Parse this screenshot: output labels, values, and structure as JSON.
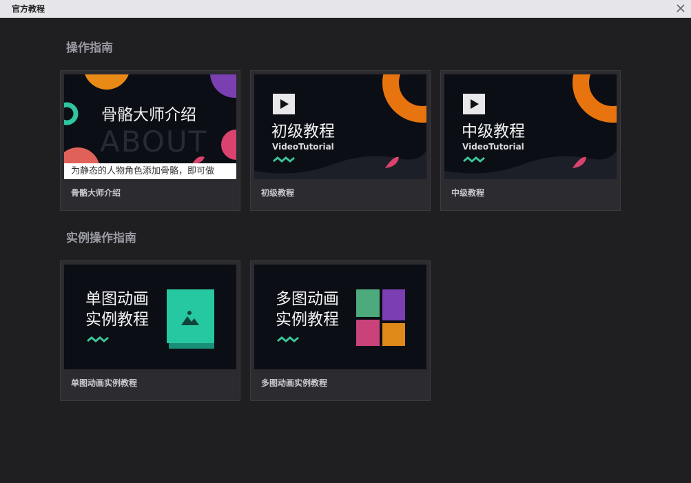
{
  "window": {
    "title": "官方教程"
  },
  "sections": [
    {
      "title": "操作指南",
      "cards": [
        {
          "label": "骨骼大师介绍",
          "heading": "骨骼大师介绍",
          "watermark": "ABOUT",
          "caption": "为静态的人物角色添加骨骼，即可做"
        },
        {
          "label": "初级教程",
          "heading": "初级教程",
          "sub": "VideoTutorial"
        },
        {
          "label": "中级教程",
          "heading": "中级教程",
          "sub": "VideoTutorial"
        }
      ]
    },
    {
      "title": "实例操作指南",
      "cards": [
        {
          "label": "单图动画实例教程",
          "line1": "单图动画",
          "line2": "实例教程"
        },
        {
          "label": "多图动画实例教程",
          "line1": "多图动画",
          "line2": "实例教程"
        }
      ]
    }
  ],
  "icons": {
    "close": "close-icon",
    "play": "play-icon",
    "wave": "wave-icon",
    "image": "image-icon"
  },
  "colors": {
    "accent_green": "#2ec5a0",
    "orange": "#e98a17",
    "purple": "#7a3fb0",
    "pink": "#d9436e",
    "grid_green": "#4caa7c",
    "grid_purple": "#7b3fb3",
    "grid_pink": "#c9437a",
    "grid_orange": "#df8a18"
  }
}
